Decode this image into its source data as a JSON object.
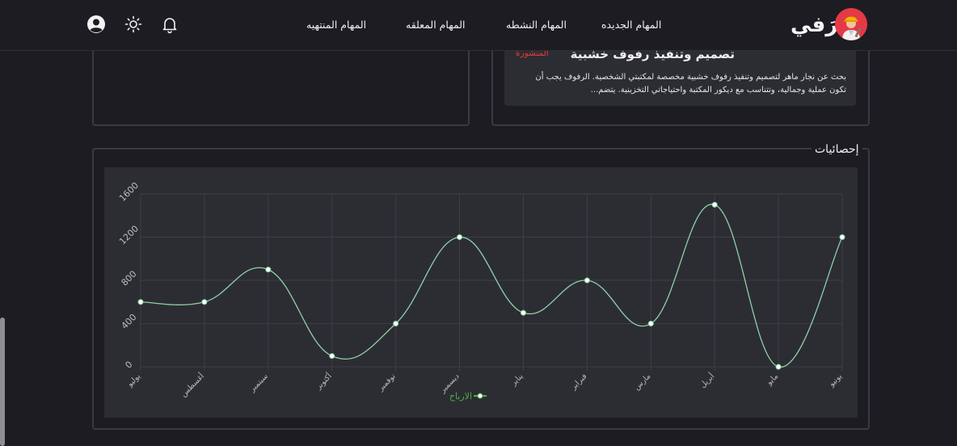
{
  "header": {
    "brand": "حرَفي",
    "nav": [
      {
        "label": "المهام الجديده"
      },
      {
        "label": "المهام النشطه"
      },
      {
        "label": "المهام المعلقه"
      },
      {
        "label": "المهام المنتهيه"
      }
    ],
    "icons": [
      "user-circle-icon",
      "sun-icon",
      "bell-icon"
    ]
  },
  "task": {
    "title": "تصميم وتنفيذ رفوف خشبية",
    "status": "المنشورة",
    "status_color": "#e53935",
    "description": "بحث عن نجار ماهر لتصميم وتنفيذ رفوف خشبية مخصصة لمكتبتي الشخصية. الرفوف يجب أن تكون عملية وجمالية، وتتناسب مع ديكور المكتبة واحتياجاتي التخزينية. يتضم..."
  },
  "stats": {
    "title": "إحصائيات"
  },
  "chart_data": {
    "type": "line",
    "categories": [
      "يوليو",
      "أغسطس",
      "سبتمبر",
      "أكتوبر",
      "نوفمبر",
      "ديسمبر",
      "يناير",
      "فبراير",
      "مارس",
      "أبريل",
      "مايو",
      "يونيو"
    ],
    "series": [
      {
        "name": "الارباح",
        "values": [
          600,
          600,
          900,
          100,
          400,
          1200,
          500,
          800,
          400,
          1500,
          0,
          1200
        ],
        "color": "#8fd1a8"
      }
    ],
    "y_ticks": [
      "0",
      "400",
      "800",
      "1200",
      "1600"
    ],
    "ylim": [
      0,
      1600
    ],
    "grid": true,
    "legend": "bottom",
    "legend_color": "#4caf50"
  }
}
